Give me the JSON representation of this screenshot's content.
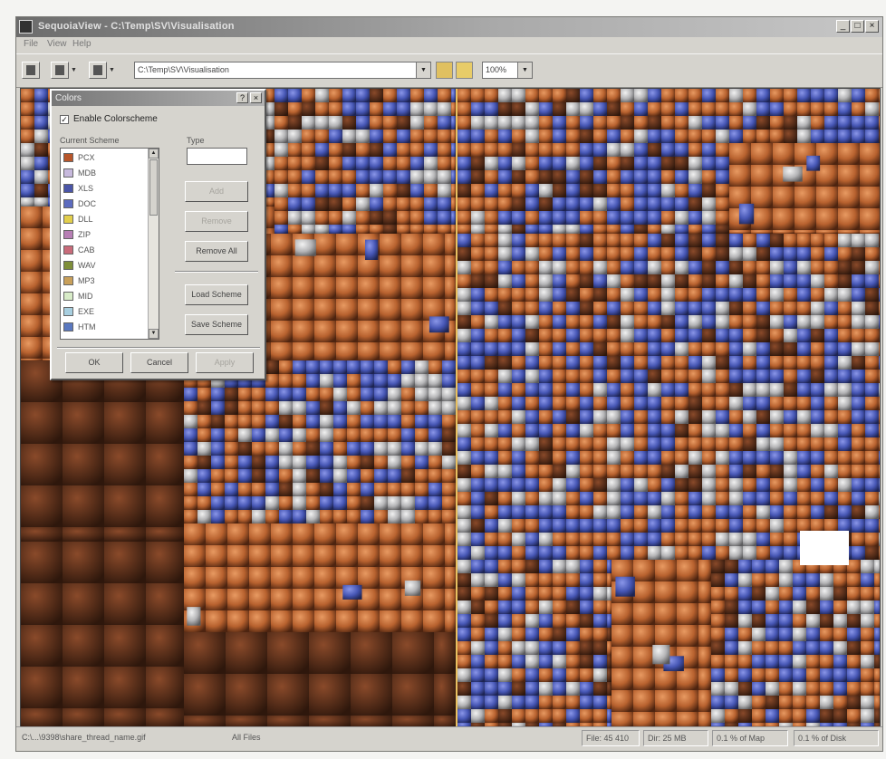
{
  "window": {
    "title": "SequoiaView - C:\\Temp\\SV\\Visualisation",
    "controls": [
      "_",
      "□",
      "×"
    ]
  },
  "menu": [
    "File",
    "View",
    "Help"
  ],
  "toolbar": {
    "path": "C:\\Temp\\SV\\Visualisation",
    "zoom": "100%"
  },
  "dialog": {
    "title": "Colors",
    "enable_label": "Enable Colorscheme",
    "enable_checked": "✓",
    "scheme_label": "Current Scheme",
    "type_label": "Type",
    "type_value": "",
    "items": [
      {
        "label": "PCX",
        "color": "#b8562a"
      },
      {
        "label": "MDB",
        "color": "#c7b9dd"
      },
      {
        "label": "XLS",
        "color": "#4a55a8"
      },
      {
        "label": "DOC",
        "color": "#5c6bbf"
      },
      {
        "label": "DLL",
        "color": "#e3cf4c"
      },
      {
        "label": "ZIP",
        "color": "#b77fb5"
      },
      {
        "label": "CAB",
        "color": "#c96b7a"
      },
      {
        "label": "WAV",
        "color": "#7f8f3a"
      },
      {
        "label": "MP3",
        "color": "#c9a05a"
      },
      {
        "label": "MID",
        "color": "#d8ecc8"
      },
      {
        "label": "EXE",
        "color": "#a8cfe0"
      },
      {
        "label": "HTM",
        "color": "#5a78c0"
      }
    ],
    "buttons": {
      "add": "Add",
      "remove": "Remove",
      "remove_all": "Remove All",
      "load": "Load Scheme",
      "save": "Save Scheme",
      "ok": "OK",
      "cancel": "Cancel",
      "apply": "Apply"
    }
  },
  "status": {
    "path": "C:\\...\\9398\\share_thread_name.gif",
    "mid": "All Files",
    "file": "File: 45 410",
    "dir": "Dir: 25 MB",
    "pct_map": "0.1 % of Map",
    "pct_disk": "0.1 % of Disk"
  },
  "colors": {
    "bg": "#f4f4f2",
    "brown": "#b8622f",
    "blue": "#4656b4",
    "gray": "#b4b4b6"
  }
}
